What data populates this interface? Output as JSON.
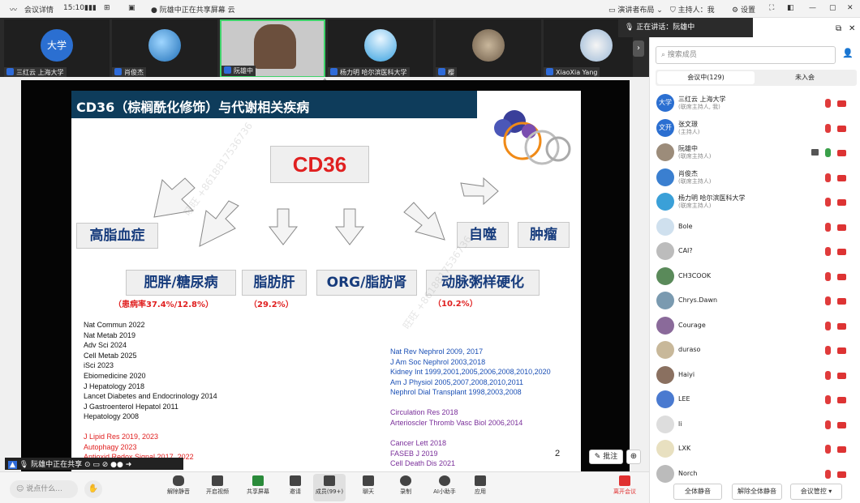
{
  "topbar": {
    "app": "会议详情",
    "time": "15:10",
    "sharing": "阮雄中正在共享屏幕",
    "speaker_view": "演讲者布局",
    "host": "主持人：我",
    "settings": "设置"
  },
  "strip": {
    "tiles": [
      {
        "name": "三红云  上海大学",
        "avatar": "大学"
      },
      {
        "name": "肖俊杰",
        "avatar": ""
      },
      {
        "name": "阮雄中",
        "avatar": ""
      },
      {
        "name": "杨力明 哈尔滨医科大学",
        "avatar": ""
      },
      {
        "name": "樱",
        "avatar": ""
      },
      {
        "name": "XiaoXia Yang",
        "avatar": ""
      }
    ],
    "speaking": "正在讲话：阮雄中"
  },
  "slide": {
    "title": "CD36（棕榈酰化修饰）与代谢相关疾病",
    "center": "CD36",
    "boxes": {
      "gaozhi": "高脂血症",
      "zishi": "自噬",
      "zhongliu": "肿瘤",
      "feipang": "肥胖/糖尿病",
      "zhifanggan": "脂肪肝",
      "org": "ORG/脂肪肾",
      "dongmai": "动脉粥样硬化"
    },
    "rates": {
      "feipang": "（患病率37.4%/12.8%）",
      "gan": "（29.2%）",
      "dongmai": "（10.2%）"
    },
    "refs_left": [
      "Nat Commun 2022",
      "Nat Metab 2019",
      "Adv Sci 2024",
      "Cell Metab 2025",
      "iSci 2023",
      "Ebiomedicine 2020",
      "J Hepatology 2018",
      "Lancet Diabetes and Endocrinology 2014",
      "J Gastroenterol Hepatol 2011",
      "Hepatology 2008"
    ],
    "refs_left_red": [
      "J Lipid Res 2019, 2023",
      "Autophagy 2023",
      "Antioxid Redox Signal 2017, 2022"
    ],
    "refs_right_blue": [
      "Nat Rev Nephrol 2009, 2017",
      "J Am Soc Nephrol 2003,2018",
      "Kidney Int 1999,2001,2005,2006,2008,2010,2020",
      "Am J Physiol  2005,2007,2008,2010,2011",
      "Nephrol Dial Transplant 1998,2003,2008"
    ],
    "refs_right_purple": [
      "Circulation Res 2018",
      "Arterioscler Thromb Vasc Biol 2006,2014"
    ],
    "refs_right_purple2": [
      "Cancer Lett 2018",
      "FASEB J 2019",
      "Cell Death Dis 2021"
    ],
    "page": "2",
    "watermark": "旺旺 +8618817536736"
  },
  "stage": {
    "presenter": "阮雄中正在共享",
    "annotate": "批注"
  },
  "bottombar": {
    "chat_placeholder": "说点什么...",
    "items": [
      "解除静音",
      "开启视频",
      "共享屏幕",
      "邀请",
      "成员(99+)",
      "聊天",
      "录制",
      "AI小助手",
      "应用",
      "离开会议"
    ]
  },
  "panel": {
    "search": "搜索成员",
    "tab_in": "会议中(129)",
    "tab_out": "未入会",
    "members": [
      {
        "name": "三红云  上海大学",
        "role": "(联席主持人, 我)",
        "av": "大学"
      },
      {
        "name": "张文璟",
        "role": "(主持人)",
        "av": "文开"
      },
      {
        "name": "阮雄中",
        "role": "(联席主持人)",
        "av": ""
      },
      {
        "name": "肖俊杰",
        "role": "(联席主持人)",
        "av": ""
      },
      {
        "name": "杨力明 哈尔滨医科大学",
        "role": "(联席主持人)",
        "av": ""
      },
      {
        "name": "Bole",
        "role": "",
        "av": ""
      },
      {
        "name": "CAI?",
        "role": "",
        "av": ""
      },
      {
        "name": "CH3COOK",
        "role": "",
        "av": ""
      },
      {
        "name": "Chrys.Dawn",
        "role": "",
        "av": ""
      },
      {
        "name": "Courage",
        "role": "",
        "av": ""
      },
      {
        "name": "duraso",
        "role": "",
        "av": ""
      },
      {
        "name": "Haiyi",
        "role": "",
        "av": ""
      },
      {
        "name": "LEE",
        "role": "",
        "av": ""
      },
      {
        "name": "li",
        "role": "",
        "av": ""
      },
      {
        "name": "LXK",
        "role": "",
        "av": ""
      },
      {
        "name": "Norch",
        "role": "",
        "av": ""
      }
    ],
    "btn_mute_all": "全体静音",
    "btn_unmute_all": "解除全体静音",
    "btn_control": "会议管控"
  }
}
